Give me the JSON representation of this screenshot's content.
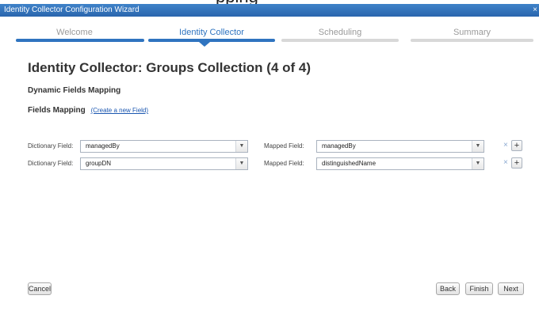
{
  "top_fragment": "pping",
  "window": {
    "title": "Identity Collector Configuration Wizard",
    "close": "×"
  },
  "steps": [
    {
      "label": "Welcome",
      "state": "done"
    },
    {
      "label": "Identity Collector",
      "state": "active"
    },
    {
      "label": "Scheduling",
      "state": "pending"
    },
    {
      "label": "Summary",
      "state": "pending"
    }
  ],
  "page_title": "Identity Collector: Groups Collection (4 of 4)",
  "section_title": "Dynamic Fields Mapping",
  "fields_mapping": {
    "label": "Fields Mapping",
    "create_link": "(Create a new Field)"
  },
  "mappings": [
    {
      "dictionary_label": "Dictionary Field:",
      "dictionary_value": "managedBy",
      "mapped_label": "Mapped Field:",
      "mapped_value": "managedBy"
    },
    {
      "dictionary_label": "Dictionary Field:",
      "dictionary_value": "groupDN",
      "mapped_label": "Mapped Field:",
      "mapped_value": "distinguishedName"
    }
  ],
  "icons": {
    "dropdown": "chevron-down-icon",
    "remove": "close-icon",
    "add": "plus-icon"
  },
  "footer": {
    "cancel": "Cancel",
    "back": "Back",
    "finish": "Finish",
    "next": "Next"
  },
  "colors": {
    "accent": "#2f74c0",
    "titlebar": "#2a66ad",
    "step_pending": "#d8d8d8"
  }
}
